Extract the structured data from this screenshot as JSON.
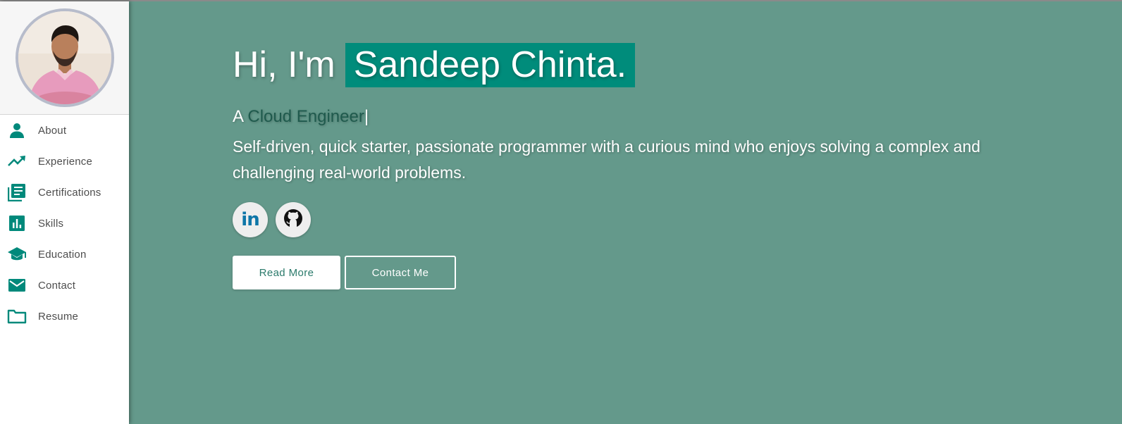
{
  "sidebar": {
    "avatar_alt": "Profile photo",
    "items": [
      {
        "label": "About",
        "icon": "person-icon"
      },
      {
        "label": "Experience",
        "icon": "trending-up-icon"
      },
      {
        "label": "Certifications",
        "icon": "library-books-icon"
      },
      {
        "label": "Skills",
        "icon": "bar-chart-icon"
      },
      {
        "label": "Education",
        "icon": "school-icon"
      },
      {
        "label": "Contact",
        "icon": "email-icon"
      },
      {
        "label": "Resume",
        "icon": "folder-icon"
      }
    ]
  },
  "hero": {
    "greeting_prefix": "Hi, I'm",
    "name": "Sandeep Chinta.",
    "role_prefix": "A",
    "role": "Cloud Engineer",
    "cursor": "|",
    "tagline": "Self-driven, quick starter, passionate programmer with a curious mind who enjoys solving a complex and challenging real-world problems.",
    "socials": [
      {
        "name": "LinkedIn",
        "icon": "linkedin-icon",
        "text": "in"
      },
      {
        "name": "GitHub",
        "icon": "github-icon"
      }
    ],
    "buttons": {
      "primary": "Read More",
      "secondary": "Contact Me"
    }
  },
  "colors": {
    "accent": "#00897b",
    "hero_background": "#64998b",
    "name_highlight": "#008c7b",
    "role_text": "#1f5a4d"
  }
}
